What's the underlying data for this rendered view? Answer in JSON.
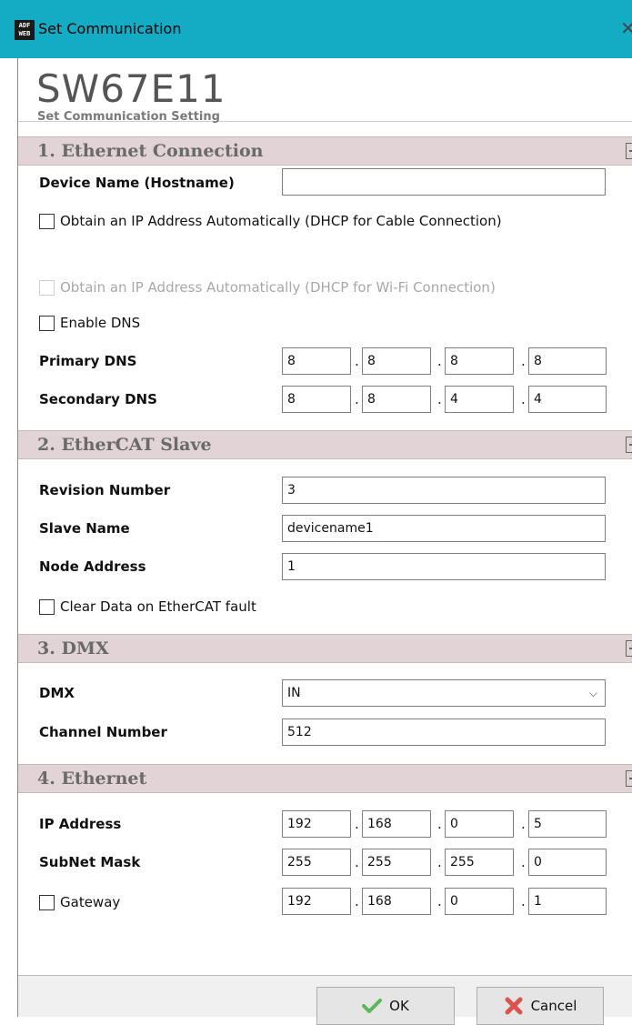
{
  "window": {
    "title": "Set Communication",
    "close_glyph": "✕",
    "icon_text": "ADF WEB"
  },
  "header": {
    "title": "SW67E11",
    "subtitle": "Set Communication Setting"
  },
  "sections": {
    "ethernet_connection": {
      "title": "1. Ethernet Connection",
      "hostname_label": "Device Name (Hostname)",
      "hostname_value": "",
      "dhcp_cable_label": "Obtain an IP Address Automatically (DHCP for Cable Connection)",
      "dhcp_cable_checked": false,
      "dhcp_wifi_label": "Obtain an IP Address Automatically (DHCP for Wi-Fi Connection)",
      "dhcp_wifi_checked": false,
      "enable_dns_label": "Enable DNS",
      "enable_dns_checked": false,
      "primary_dns_label": "Primary DNS",
      "primary_dns": [
        "8",
        "8",
        "8",
        "8"
      ],
      "secondary_dns_label": "Secondary DNS",
      "secondary_dns": [
        "8",
        "8",
        "4",
        "4"
      ]
    },
    "ethercat_slave": {
      "title": "2. EtherCAT Slave",
      "revision_label": "Revision Number",
      "revision_value": "3",
      "slave_name_label": "Slave Name",
      "slave_name_value": "devicename1",
      "node_address_label": "Node Address",
      "node_address_value": "1",
      "clear_data_label": "Clear Data on EtherCAT fault",
      "clear_data_checked": false
    },
    "dmx": {
      "title": "3. DMX",
      "dmx_label": "DMX",
      "dmx_value": "IN",
      "channel_label": "Channel Number",
      "channel_value": "512"
    },
    "ethernet": {
      "title": "4. Ethernet",
      "ip_label": "IP Address",
      "ip": [
        "192",
        "168",
        "0",
        "5"
      ],
      "subnet_label": "SubNet Mask",
      "subnet": [
        "255",
        "255",
        "255",
        "0"
      ],
      "gateway_label": "Gateway",
      "gateway_checked": false,
      "gateway": [
        "192",
        "168",
        "0",
        "1"
      ]
    }
  },
  "footer": {
    "ok_label": "OK",
    "cancel_label": "Cancel"
  },
  "colors": {
    "titlebar": "#13acc4",
    "section_bg": "#e2d3d6",
    "ok_check": "#5cb85c",
    "cancel_x": "#d9534f"
  }
}
